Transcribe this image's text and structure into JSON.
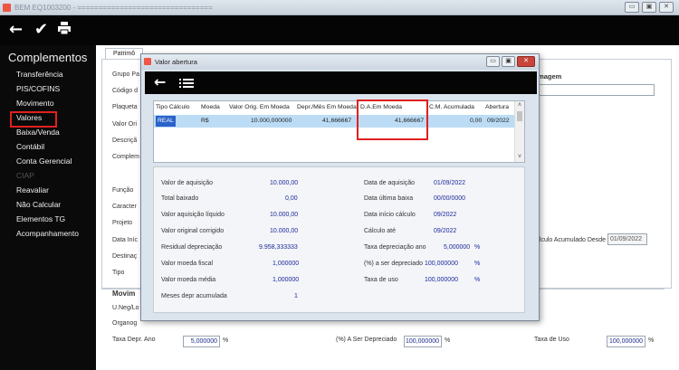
{
  "window": {
    "title": "BEM EQ1003200 - ================================"
  },
  "toolbar": {
    "back_icon": "arrow-left-icon",
    "confirm_icon": "check-icon",
    "print_icon": "printer-icon"
  },
  "sidebar": {
    "heading": "Complementos",
    "items": [
      {
        "label": "Transferência"
      },
      {
        "label": "PIS/COFINS"
      },
      {
        "label": "Movimento"
      },
      {
        "label": "Valores"
      },
      {
        "label": "Baixa/Venda"
      },
      {
        "label": "Contábil"
      },
      {
        "label": "Conta Gerencial"
      },
      {
        "label": "CIAP"
      },
      {
        "label": "Reavaliar"
      },
      {
        "label": "Não Calcular"
      },
      {
        "label": "Elementos TG"
      },
      {
        "label": "Acompanhamento"
      }
    ]
  },
  "main": {
    "tab": "Patrimô",
    "labels": [
      "Grupo Pa",
      "Código d",
      "Plaqueta",
      "Valor Ori",
      "Descriçã",
      "Complem",
      "Função",
      "Caracter",
      "Projeto",
      "Data Iníc",
      "Destinaç",
      "Tipo"
    ],
    "imagem": "Imagem",
    "cad_label": "álculo Acumulado Desde",
    "cad_value": "01/09/2022",
    "mov_title": "Movim",
    "mov_labels": [
      "U.Neg/Lo",
      "Organog"
    ],
    "taxa_depr_ano_label": "Taxa Depr. Ano",
    "taxa_depr_ano_value": "5,000000",
    "pct_depreciado_label": "(%) A Ser Depreciado",
    "pct_depreciado_value": "100,000000",
    "taxa_uso_label": "Taxa de Uso",
    "taxa_uso_value": "100,000000",
    "pct": "%"
  },
  "dialog": {
    "title": "Valor abertura",
    "grid": {
      "headers": [
        "Tipo Cálculo",
        "Moeda",
        "Valor Orig. Em Moeda",
        "Depr./Mês Em Moeda",
        "D.A.Em Moeda",
        "C.M. Acumulada",
        "Abertura"
      ],
      "row": [
        "REAL",
        "R$",
        "10.000,000000",
        "41,666667",
        "41,666667",
        "0,00",
        "09/2022"
      ]
    },
    "details": {
      "valor_aquisicao_label": "Valor de aquisição",
      "valor_aquisicao": "10.000,00",
      "total_baixado_label": "Total baixado",
      "total_baixado": "0,00",
      "valor_aquisicao_liquido_label": "Valor aquisição líquido",
      "valor_aquisicao_liquido": "10.000,00",
      "valor_original_corrigido_label": "Valor original corrigido",
      "valor_original_corrigido": "10.000,00",
      "residual_depreciacao_label": "Residual depreciação",
      "residual_depreciacao": "9.958,333333",
      "valor_moeda_fiscal_label": "Valor moeda fiscal",
      "valor_moeda_fiscal": "1,000000",
      "valor_moeda_media_label": "Valor moeda média",
      "valor_moeda_media": "1,000000",
      "meses_depr_label": "Meses depr acumulada",
      "meses_depr": "1",
      "data_aquisicao_label": "Data de aquisição",
      "data_aquisicao": "01/09/2022",
      "data_ultima_baixa_label": "Data última baixa",
      "data_ultima_baixa": "00/00/0000",
      "data_inicio_calculo_label": "Data início cálculo",
      "data_inicio_calculo": "09/2022",
      "calculo_ate_label": "Cálculo até",
      "calculo_ate": "09/2022",
      "taxa_depreciacao_ano_label": "Taxa depreciação ano",
      "taxa_depreciacao_ano": "5,000000",
      "pct_ser_depreciado_label": "(%) a ser depreciado",
      "pct_ser_depreciado": "100,000000",
      "taxa_uso_label": "Taxa de uso",
      "taxa_uso": "100,000000",
      "pct": "%"
    }
  }
}
